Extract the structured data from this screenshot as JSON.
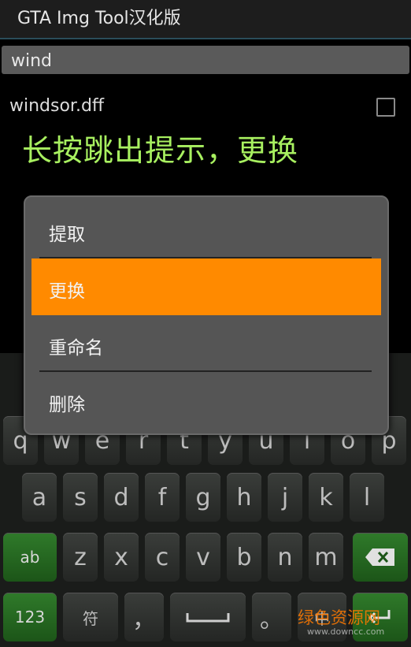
{
  "titlebar": {
    "title": "GTA Img Tool汉化版"
  },
  "search": {
    "value": "wind"
  },
  "files": [
    {
      "name": "windsor.dff"
    }
  ],
  "hint": "长按跳出提示，更换",
  "menu": {
    "items": [
      {
        "label": "提取"
      },
      {
        "label": "更换",
        "selected": true
      },
      {
        "label": "重命名"
      },
      {
        "label": "删除"
      }
    ]
  },
  "keyboard": {
    "row1": [
      "q",
      "w",
      "e",
      "r",
      "t",
      "y",
      "u",
      "i",
      "o",
      "p"
    ],
    "row2": [
      "a",
      "s",
      "d",
      "f",
      "g",
      "h",
      "j",
      "k",
      "l"
    ],
    "row3_left": "ab",
    "row3": [
      "z",
      "x",
      "c",
      "v",
      "b",
      "n",
      "m"
    ],
    "backspace_icon": "backspace-icon",
    "row4": {
      "num": "123",
      "sym": "符",
      "comma": "，",
      "space_icon": "space-bar-icon",
      "period": "。",
      "lang": "中",
      "enter_icon": "enter-icon"
    }
  },
  "watermark": {
    "text": "绿色资源网",
    "url": "www.downcc.com"
  },
  "colors": {
    "accent": "#ff8a00",
    "hint": "#a8f060",
    "key_green": "#2f7a2a"
  }
}
